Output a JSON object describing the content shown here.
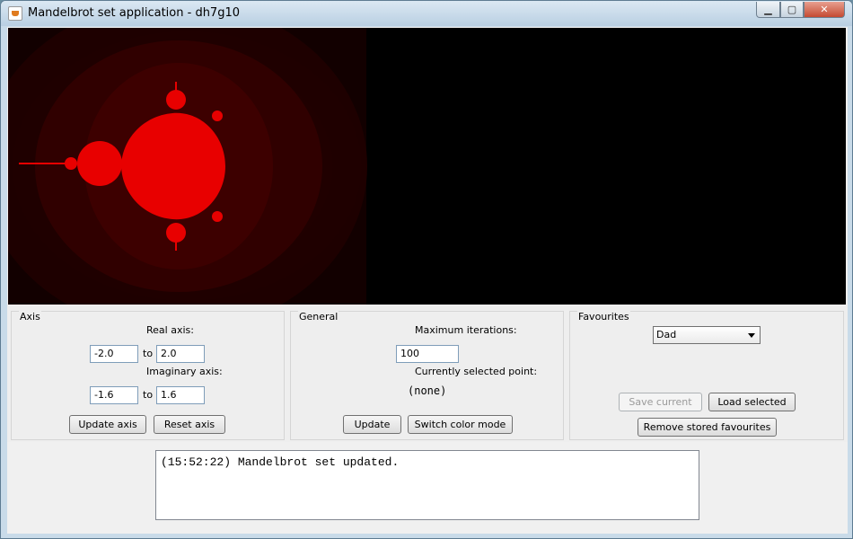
{
  "window": {
    "title": "Mandelbrot set application - dh7g10",
    "controls": {
      "minimize": "▁",
      "maximize": "▢",
      "close": "✕"
    }
  },
  "canvas": {
    "view": {
      "real_min": -2.0,
      "real_max": 2.0,
      "imag_min": -1.6,
      "imag_max": 1.6
    },
    "colors": {
      "set": "#ff0000",
      "halo": "#3a0000",
      "background": "#000000"
    }
  },
  "axis_panel": {
    "legend": "Axis",
    "real_label": "Real axis:",
    "real_from": "-2.0",
    "real_to": "2.0",
    "imag_label": "Imaginary axis:",
    "imag_from": "-1.6",
    "imag_to": "1.6",
    "to_label": "to",
    "update_button": "Update axis",
    "reset_button": "Reset axis"
  },
  "general_panel": {
    "legend": "General",
    "max_iter_label": "Maximum iterations:",
    "max_iter_value": "100",
    "selected_point_label": "Currently selected point:",
    "selected_point_value": "(none)",
    "update_button": "Update",
    "switch_color_button": "Switch color mode"
  },
  "favourites_panel": {
    "legend": "Favourites",
    "selected": "Dad",
    "save_button": "Save current",
    "load_button": "Load selected",
    "remove_button": "Remove stored favourites"
  },
  "log": {
    "lines": [
      "(15:52:22) Mandelbrot set updated."
    ]
  }
}
